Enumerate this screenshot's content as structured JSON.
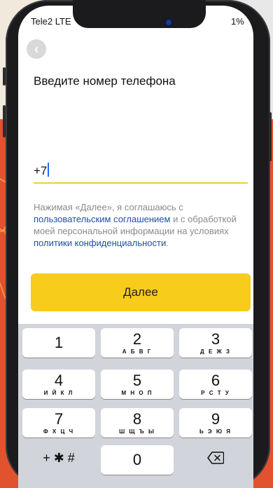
{
  "status_bar": {
    "carrier": "Tele2  LTE",
    "battery": "1%"
  },
  "screen": {
    "back_icon": "chevron-left-icon",
    "title": "Введите номер телефона",
    "phone_value": "+7"
  },
  "terms": {
    "part1": "Нажимая «Далее», я соглашаюсь с ",
    "link1": "пользовательским соглашением",
    "part2": " и с обработкой моей персональной информации на условиях ",
    "link2": "политики конфиденциальности",
    "part3": "."
  },
  "next_label": "Далее",
  "keyboard": {
    "k1": {
      "num": "1",
      "sub": ""
    },
    "k2": {
      "num": "2",
      "sub": "А Б В Г"
    },
    "k3": {
      "num": "3",
      "sub": "Д Е Ж З"
    },
    "k4": {
      "num": "4",
      "sub": "И Й К Л"
    },
    "k5": {
      "num": "5",
      "sub": "М Н О П"
    },
    "k6": {
      "num": "6",
      "sub": "Р С Т У"
    },
    "k7": {
      "num": "7",
      "sub": "Ф Х Ц Ч"
    },
    "k8": {
      "num": "8",
      "sub": "Ш Щ Ъ Ы"
    },
    "k9": {
      "num": "9",
      "sub": "Ь Э Ю Я"
    },
    "symbols": "+ ✱ #",
    "k0": "0",
    "delete_icon": "backspace-icon"
  }
}
